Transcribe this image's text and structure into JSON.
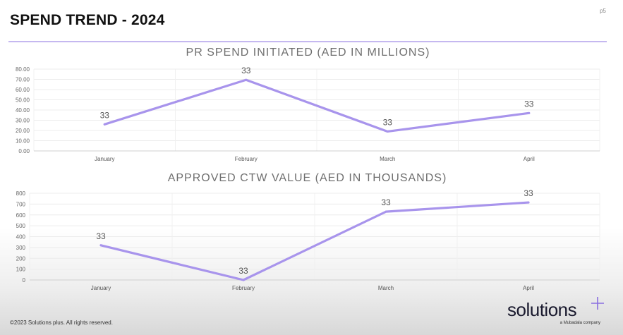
{
  "header": {
    "title": "SPEND TREND - 2024",
    "page_number": "p5"
  },
  "colors": {
    "accent": "#a08ae8",
    "divider": "#c5b8f0",
    "line": "#a894ec"
  },
  "chart_data": [
    {
      "type": "line",
      "title": "PR SPEND INITIATED (AED IN MILLIONS)",
      "categories": [
        "January",
        "February",
        "March",
        "April"
      ],
      "values": [
        26,
        69.5,
        19,
        37
      ],
      "data_labels": [
        "33",
        "33",
        "33",
        "33"
      ],
      "ylim": [
        0,
        80
      ],
      "yticks": [
        "0.00",
        "10.00",
        "20.00",
        "30.00",
        "40.00",
        "50.00",
        "60.00",
        "70.00",
        "80.00"
      ],
      "grid": true,
      "xlabel": "",
      "ylabel": ""
    },
    {
      "type": "line",
      "title": "APPROVED CTW VALUE (AED IN THOUSANDS)",
      "categories": [
        "January",
        "February",
        "March",
        "April"
      ],
      "values": [
        320,
        0,
        630,
        715
      ],
      "data_labels": [
        "33",
        "33",
        "33",
        "33"
      ],
      "ylim": [
        0,
        800
      ],
      "yticks": [
        "0",
        "100",
        "200",
        "300",
        "400",
        "500",
        "600",
        "700",
        "800"
      ],
      "grid": true,
      "xlabel": "",
      "ylabel": ""
    }
  ],
  "footer": {
    "copyright": "©2023 Solutions plus. All rights reserved.",
    "logo_text": "solutions",
    "logo_tagline": "a Mubadala company"
  }
}
